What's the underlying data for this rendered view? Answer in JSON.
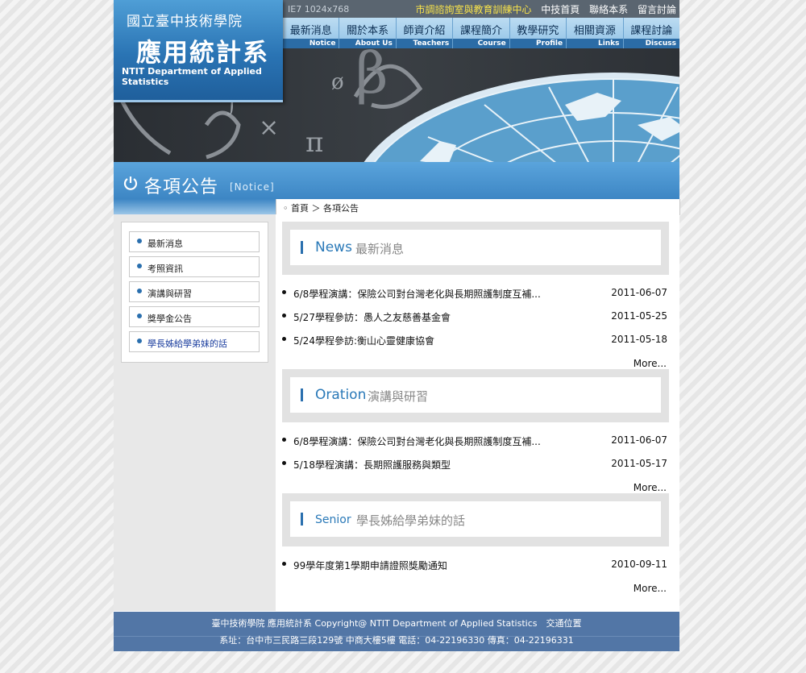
{
  "logo": {
    "school": "國立臺中技術學院",
    "dept": "應用統計系",
    "dept_en": "NTIT Department of Applied Statistics"
  },
  "topbar": {
    "ie_note": "IE7 1024x768",
    "links": [
      "市調諮詢室與教育訓練中心",
      "中技首頁",
      "聯絡本系",
      "留言討論"
    ]
  },
  "nav": [
    {
      "cn": "最新消息",
      "en": "Notice"
    },
    {
      "cn": "關於本系",
      "en": "About Us"
    },
    {
      "cn": "師資介紹",
      "en": "Teachers"
    },
    {
      "cn": "課程簡介",
      "en": "Course"
    },
    {
      "cn": "教學研究",
      "en": "Profile"
    },
    {
      "cn": "相關資源",
      "en": "Links"
    },
    {
      "cn": "課程討論",
      "en": "Discuss"
    }
  ],
  "banner": {
    "symbols": [
      "β",
      "ø",
      "π",
      "×",
      "∫"
    ]
  },
  "page_title": {
    "cn": "各項公告",
    "en": "[Notice]"
  },
  "breadcrumb": {
    "text": "◦ 首頁 ＞ 各項公告"
  },
  "sidebar": {
    "items": [
      "最新消息",
      "考照資訊",
      "演講與研習",
      "獎學金公告",
      "學長姊給學弟妹的話"
    ]
  },
  "sections": [
    {
      "en": "News",
      "cn": "最新消息",
      "items": [
        {
          "title": "6/8學程演講：保險公司對台灣老化與長期照護制度互補...",
          "date": "2011-06-07"
        },
        {
          "title": "5/27學程參訪：愚人之友慈善基金會",
          "date": "2011-05-25"
        },
        {
          "title": "5/24學程參訪:衡山心靈健康協會",
          "date": "2011-05-18"
        }
      ],
      "more": "More..."
    },
    {
      "en": "Oration",
      "cn": "演講與研習",
      "items": [
        {
          "title": "6/8學程演講：保險公司對台灣老化與長期照護制度互補...",
          "date": "2011-06-07"
        },
        {
          "title": "5/18學程演講：長期照護服務與類型",
          "date": "2011-05-17"
        }
      ],
      "more": "More..."
    },
    {
      "en": "Senior",
      "cn": "學長姊給學弟妹的話",
      "items": [
        {
          "title": "99學年度第1學期申請證照獎勵通知",
          "date": "2010-09-11"
        }
      ],
      "more": "More..."
    }
  ],
  "footer": {
    "line1": "臺中技術學院 應用統計系 Copyright@ NTIT Department of Applied Statistics　交通位置",
    "line2": "系址：台中市三民路三段129號 中商大樓5樓 電話：04-22196330 傳真：04-22196331"
  },
  "colors": {
    "accent": "#2a6fae",
    "footer": "#5276a6",
    "topbar": "#5a6570"
  }
}
